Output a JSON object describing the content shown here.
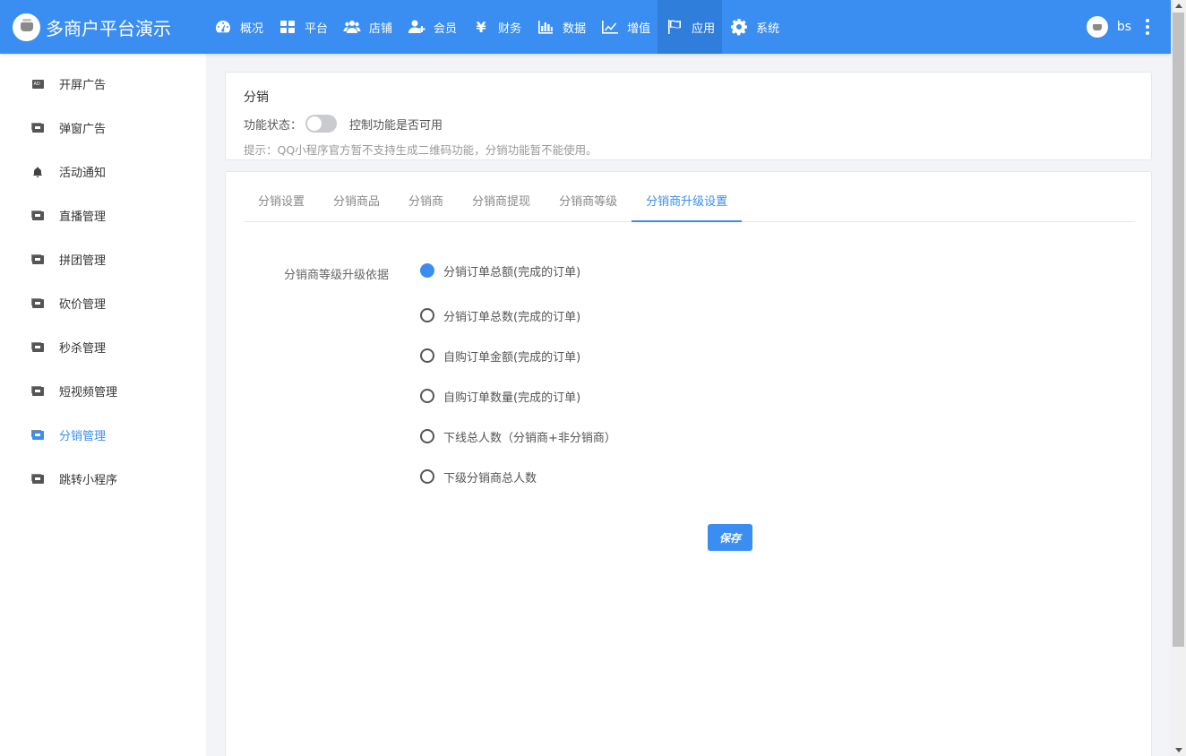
{
  "app": {
    "title": "多商户平台演示",
    "user": "bs"
  },
  "nav": {
    "items": [
      {
        "label": "概况",
        "icon": "dashboard-icon"
      },
      {
        "label": "平台",
        "icon": "grid-icon"
      },
      {
        "label": "店铺",
        "icon": "users-icon"
      },
      {
        "label": "会员",
        "icon": "user-add-icon"
      },
      {
        "label": "财务",
        "icon": "yen-icon"
      },
      {
        "label": "数据",
        "icon": "bar-chart-icon"
      },
      {
        "label": "增值",
        "icon": "line-chart-icon"
      },
      {
        "label": "应用",
        "icon": "flag-icon",
        "active": true
      },
      {
        "label": "系统",
        "icon": "gear-icon"
      }
    ]
  },
  "sidebar": {
    "items": [
      {
        "label": "开屏广告",
        "icon": "ad-icon"
      },
      {
        "label": "弹窗广告",
        "icon": "ad-window-icon"
      },
      {
        "label": "活动通知",
        "icon": "bell-icon"
      },
      {
        "label": "直播管理",
        "icon": "ad-window-icon"
      },
      {
        "label": "拼团管理",
        "icon": "ad-window-icon"
      },
      {
        "label": "砍价管理",
        "icon": "ad-window-icon"
      },
      {
        "label": "秒杀管理",
        "icon": "ad-window-icon"
      },
      {
        "label": "短视频管理",
        "icon": "ad-window-icon"
      },
      {
        "label": "分销管理",
        "icon": "ad-window-icon",
        "active": true
      },
      {
        "label": "跳转小程序",
        "icon": "ad-window-icon"
      }
    ]
  },
  "header_card": {
    "title": "分销",
    "status_label": "功能状态：",
    "toggle_on": false,
    "toggle_desc": "控制功能是否可用",
    "hint": "提示：QQ小程序官方暂不支持生成二维码功能，分销功能暂不能使用。"
  },
  "tabs": [
    {
      "label": "分销设置"
    },
    {
      "label": "分销商品"
    },
    {
      "label": "分销商"
    },
    {
      "label": "分销商提现"
    },
    {
      "label": "分销商等级"
    },
    {
      "label": "分销商升级设置",
      "active": true
    }
  ],
  "form": {
    "label": "分销商等级升级依据",
    "options": [
      {
        "label": "分销订单总额(完成的订单)",
        "checked": true
      },
      {
        "label": "分销订单总数(完成的订单)",
        "checked": false
      },
      {
        "label": "自购订单金额(完成的订单)",
        "checked": false
      },
      {
        "label": "自购订单数量(完成的订单)",
        "checked": false
      },
      {
        "label": "下线总人数（分销商+非分销商）",
        "checked": false
      },
      {
        "label": "下级分销商总人数",
        "checked": false
      }
    ],
    "save_label": "保存"
  },
  "colors": {
    "primary": "#3b8ef1",
    "nav_active": "#2f7edc"
  }
}
